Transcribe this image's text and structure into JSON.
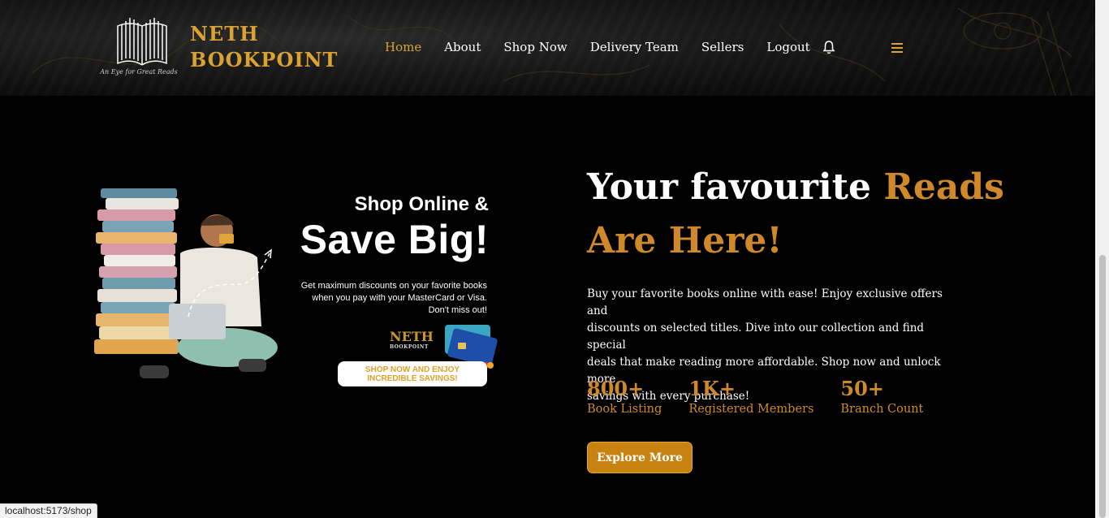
{
  "brand": {
    "name_line1": "NETH",
    "name_line2": "BOOKPOINT",
    "tagline": "An Eye for Great Reads",
    "accent": "#d9a233"
  },
  "nav": {
    "items": [
      {
        "label": "Home",
        "active": true
      },
      {
        "label": "About",
        "active": false
      },
      {
        "label": "Shop Now",
        "active": false
      },
      {
        "label": "Delivery Team",
        "active": false
      },
      {
        "label": "Sellers",
        "active": false
      },
      {
        "label": "Logout",
        "active": false
      }
    ],
    "icons": [
      "bell-icon",
      "hamburger-menu-icon"
    ]
  },
  "banner": {
    "title_line1": "Shop Online &",
    "title_line2": "Save Big!",
    "description_line1": "Get maximum discounts on your favorite books",
    "description_line2": "when you pay with your MasterCard or Visa.",
    "description_line3": "Don't miss out!",
    "mini_logo": "NETH",
    "mini_logo_sub": "BOOKPOINT",
    "cta_line1": "SHOP NOW AND ENJOY",
    "cta_line2": "INCREDIBLE SAVINGS!"
  },
  "hero": {
    "heading_white_1": "Your favourite",
    "heading_gold_1": "Reads",
    "heading_gold_2": "Are Here!",
    "paragraph_line1": "Buy your favorite books online with ease! Enjoy exclusive offers and",
    "paragraph_line2": "discounts on selected titles. Dive into our collection and find special",
    "paragraph_line3": "deals that make reading more affordable. Shop now and unlock more",
    "paragraph_line4": "savings with every purchase!",
    "stats": [
      {
        "value": "800+",
        "label": "Book Listing"
      },
      {
        "value": "1K+",
        "label": "Registered Members"
      },
      {
        "value": "50+",
        "label": "Branch Count"
      }
    ],
    "button_label": "Explore More",
    "accent": "#d0892a"
  },
  "statusbar": {
    "url": "localhost:5173/shop"
  }
}
